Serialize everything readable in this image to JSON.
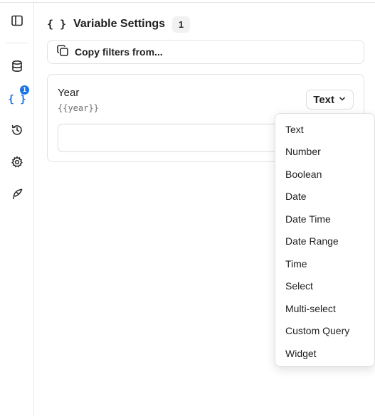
{
  "sidebar": {
    "items": [
      {
        "icon": "panel-toggle-icon"
      },
      {
        "icon": "database-icon"
      },
      {
        "icon": "variables-icon",
        "label": "{ }",
        "badge": "1",
        "active": true
      },
      {
        "icon": "history-icon"
      },
      {
        "icon": "gear-icon"
      },
      {
        "icon": "quill-icon"
      }
    ],
    "accent_color": "#1a73e8"
  },
  "header": {
    "icon_text": "{ }",
    "title": "Variable Settings",
    "count": "1"
  },
  "copy_filters": {
    "label": "Copy filters from...",
    "icon": "copy-icon"
  },
  "variable": {
    "name": "Year",
    "token": "{{year}}",
    "type_label": "Text",
    "value": ""
  },
  "type_menu": {
    "options": [
      "Text",
      "Number",
      "Boolean",
      "Date",
      "Date Time",
      "Date Range",
      "Time",
      "Select",
      "Multi-select",
      "Custom Query",
      "Widget"
    ]
  }
}
